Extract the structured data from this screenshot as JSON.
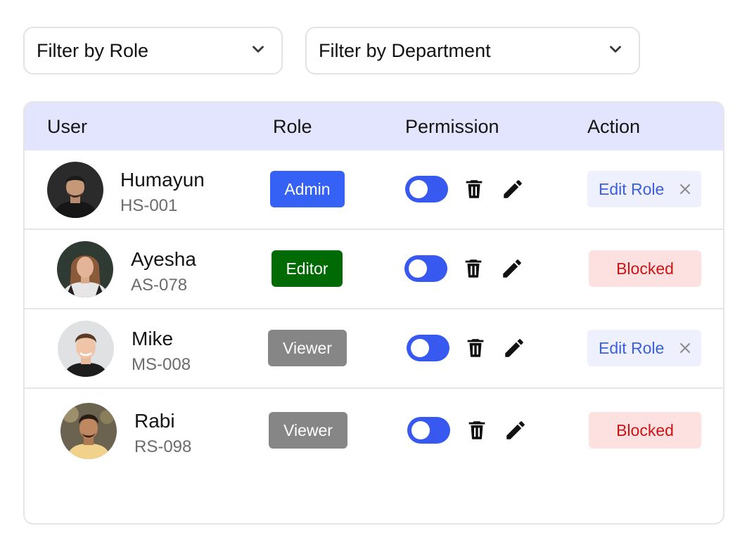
{
  "filters": {
    "role": {
      "label": "Filter by Role"
    },
    "department": {
      "label": "Filter by Department"
    }
  },
  "table": {
    "headers": {
      "user": "User",
      "role": "Role",
      "permission": "Permission",
      "action": "Action"
    },
    "rows": [
      {
        "name": "Humayun",
        "id": "HS-001",
        "role": "Admin",
        "role_color": "#3561f5",
        "permission_enabled": false,
        "action": "Edit Role",
        "action_type": "edit"
      },
      {
        "name": "Ayesha",
        "id": "AS-078",
        "role": "Editor",
        "role_color": "#006b05",
        "permission_enabled": false,
        "action": "Blocked",
        "action_type": "blocked"
      },
      {
        "name": "Mike",
        "id": "MS-008",
        "role": "Viewer",
        "role_color": "#868686",
        "permission_enabled": false,
        "action": "Edit Role",
        "action_type": "edit"
      },
      {
        "name": "Rabi",
        "id": "RS-098",
        "role": "Viewer",
        "role_color": "#868686",
        "permission_enabled": false,
        "action": "Blocked",
        "action_type": "blocked"
      }
    ]
  },
  "icons": {
    "dropdown": "chevron-down-icon",
    "delete": "trash-icon",
    "edit": "pencil-icon",
    "close": "close-icon"
  },
  "colors": {
    "header_bg": "#e2e5fd",
    "toggle": "#3759f0",
    "edit_bg": "#eef1fd",
    "edit_text": "#3a5fe0",
    "blocked_bg": "#fde1e1",
    "blocked_text": "#cc1414"
  }
}
